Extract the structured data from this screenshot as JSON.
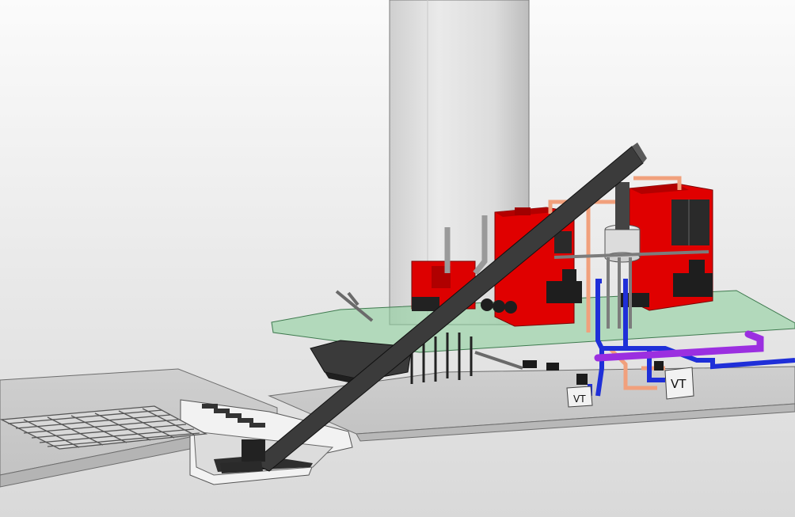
{
  "labels": {
    "vt_left": "VT",
    "vt_right": "VT"
  },
  "colors": {
    "background": "#e9e9e9",
    "boiler_red": "#dd0000",
    "boiler_dark_red": "#9a0000",
    "conveyor": "#3b3b3b",
    "platform_glass": "#8fd19e",
    "pipe_blue": "#1f2fd8",
    "pipe_purple": "#9b2fe0",
    "pipe_salmon": "#f1a07c",
    "stack_grey": "#d6d6d6"
  },
  "icons": {
    "left_grate": "grate-icon",
    "hopper": "hopper-icon",
    "duct": "duct-icon"
  }
}
